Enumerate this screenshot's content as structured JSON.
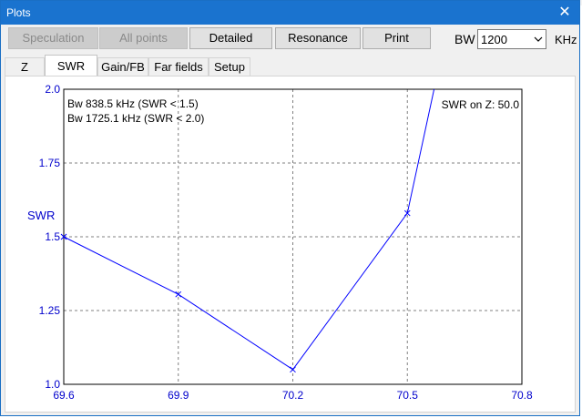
{
  "window": {
    "title": "Plots",
    "close_icon": "close-icon"
  },
  "toolbar": {
    "speculation_label": "Speculation",
    "all_points_label": "All points",
    "detailed_label": "Detailed",
    "resonance_label": "Resonance",
    "print_label": "Print",
    "bw_label": "BW",
    "bw_value": "1200",
    "bw_unit": "KHz"
  },
  "tabs": [
    {
      "label": "Z"
    },
    {
      "label": "SWR"
    },
    {
      "label": "Gain/FB"
    },
    {
      "label": "Far fields"
    },
    {
      "label": "Setup"
    }
  ],
  "colors": {
    "plot_line": "#0000ff",
    "axis_text": "#0000cc",
    "titlebar": "#1a73cf"
  },
  "chart_data": {
    "type": "line",
    "ylabel": "SWR",
    "x_ticks": [
      "69.6",
      "69.9",
      "70.2",
      "70.5",
      "70.8"
    ],
    "y_ticks": [
      "1.0",
      "1.25",
      "1.5",
      "1.75",
      "2.0"
    ],
    "xlim": [
      69.6,
      70.8
    ],
    "ylim": [
      1.0,
      2.0
    ],
    "grid": true,
    "series": [
      {
        "x": [
          69.6,
          69.9,
          70.2,
          70.5,
          70.57
        ],
        "y": [
          1.5,
          1.305,
          1.05,
          1.58,
          2.0
        ]
      }
    ],
    "annotations": {
      "bw1": "Bw 838.5 kHz (SWR < 1.5)",
      "bw2": "Bw 1725.1 kHz (SWR < 2.0)",
      "swr_on_z": "SWR on Z: 50.0"
    }
  }
}
